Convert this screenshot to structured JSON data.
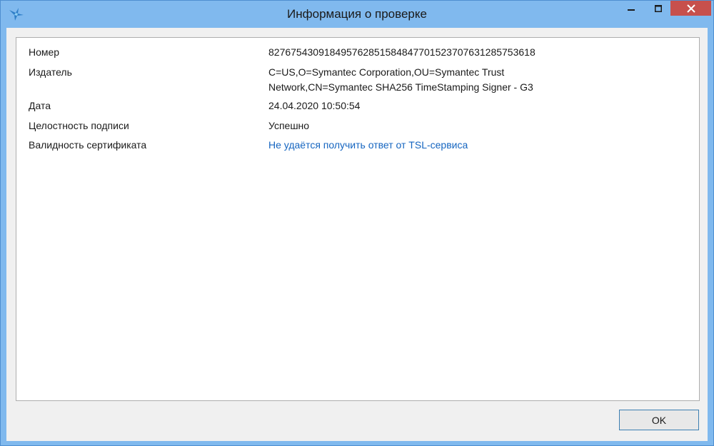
{
  "window": {
    "title": "Информация о проверке",
    "app_icon": "bird-logo-icon",
    "controls": {
      "minimize_icon": "minimize-icon",
      "maximize_icon": "maximize-icon",
      "close_icon": "close-icon"
    }
  },
  "details": [
    {
      "label": "Номер",
      "value": "82767543091849576285158484770152370763128575361 8"
    },
    {
      "label": "Издатель",
      "value_line1": "C=US,O=Symantec Corporation,OU=Symantec Trust",
      "value_line2": "Network,CN=Symantec SHA256 TimeStamping Signer - G3"
    },
    {
      "label": "Дата",
      "value": "24.04.2020 10:50:54"
    },
    {
      "label": "Целостность подписи",
      "value": "Успешно"
    },
    {
      "label": "Валидность сертификата",
      "value": "Не удаётся получить ответ от TSL-сервиса"
    }
  ],
  "buttons": {
    "ok_label": "OK"
  },
  "colors": {
    "titlebar": "#80b9ee",
    "close_button": "#c7504c",
    "link": "#1565c0"
  }
}
